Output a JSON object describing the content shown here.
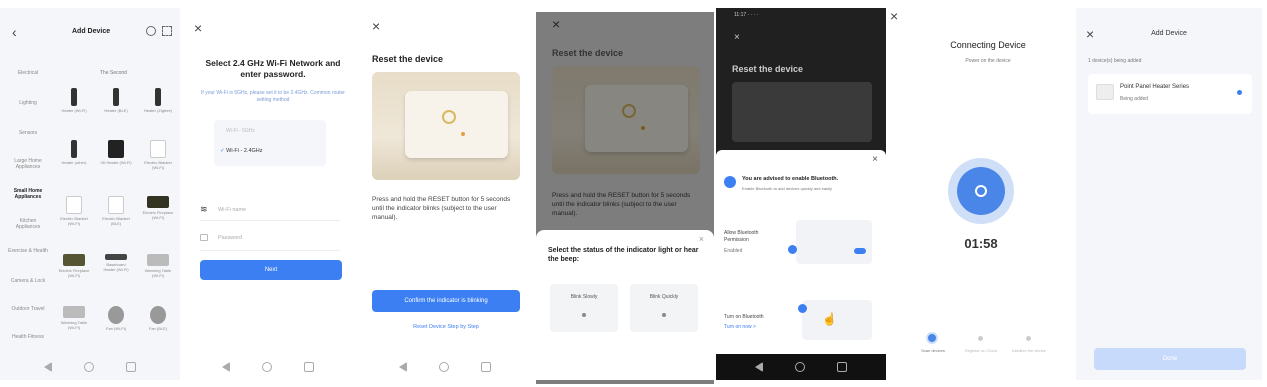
{
  "p1": {
    "title": "Add Device",
    "section": "The Second",
    "categories": [
      "Electrical",
      "Lighting",
      "Sensors",
      "Large Home Appliances",
      "Small Home Appliances",
      "Kitchen Appliances",
      "Exercise & Health",
      "Camera & Lock",
      "Outdoor Travel",
      "Health Fitness"
    ],
    "items": [
      {
        "label": "Heater (Wi-Fi)"
      },
      {
        "label": "Heater (BLE)"
      },
      {
        "label": "Heater (Zigbee)"
      },
      {
        "label": "Heater (other)"
      },
      {
        "label": "Oil Heater (Wi-Fi)"
      },
      {
        "label": "Electric Blanket (Wi-Fi)"
      },
      {
        "label": "Electric Blanket (Wi-Fi)"
      },
      {
        "label": "Electric Blanket (BLE)"
      },
      {
        "label": "Electric Fireplace (Wi-Fi)"
      },
      {
        "label": "Electric Fireplace (Wi-Fi)"
      },
      {
        "label": "Baseboard Heater (Wi-Fi)"
      },
      {
        "label": "Warming Table (Wi-Fi)"
      },
      {
        "label": "Warming Table (Wi-Fi)"
      },
      {
        "label": "Fan (Wi-Fi)"
      },
      {
        "label": "Fan (BLE)"
      }
    ]
  },
  "p2": {
    "title": "Select 2.4 GHz Wi-Fi Network and enter password.",
    "subtitle": "If your Wi-Fi is 5GHz, please set it to be 2.4GHz. Common router setting method",
    "wifi5": "Wi-Fi - 5GHz",
    "wifi24": "Wi-Fi - 2.4GHz",
    "wifi_name": "Wi-Fi name",
    "password": "Password",
    "next": "Next"
  },
  "p3": {
    "title": "Reset the device",
    "desc": "Press and hold the RESET button for 5 seconds until the indicator blinks (subject to the user manual).",
    "confirm": "Confirm the indicator is blinking",
    "stepbystep": "Reset Device Step by Step"
  },
  "p4": {
    "title": "Reset the device",
    "desc": "Press and hold the RESET button for 5 seconds until the indicator blinks (subject to the user manual).",
    "sheet_title": "Select the status of the indicator light or hear the beep:",
    "opt1": "Blink Slowly",
    "opt2": "Blink Quickly"
  },
  "p5": {
    "status": "11:17 · · · ·",
    "title": "Reset the device",
    "bt_title": "You are advised to enable Bluetooth.",
    "bt_sub": "Enable Bluetooth to add devices quickly and easily.",
    "step1": "Allow Bluetooth Permission",
    "step1_sub": "Enabled",
    "step2": "Turn on Bluetooth",
    "step2_sub": "Turn on now >"
  },
  "p6": {
    "title": "Connecting Device",
    "subtitle": "Power on the device",
    "timer": "01:58",
    "steps": [
      "Scan devices",
      "Register on Cloud",
      "Initialize the device"
    ]
  },
  "p7": {
    "title": "Add Device",
    "hint": "1 device(s) being added",
    "device_name": "Point Panel Heater Series",
    "device_status": "Being added",
    "button": "Done"
  },
  "colors": {
    "accent": "#3c7ff2",
    "circle": "#4a86e8"
  }
}
